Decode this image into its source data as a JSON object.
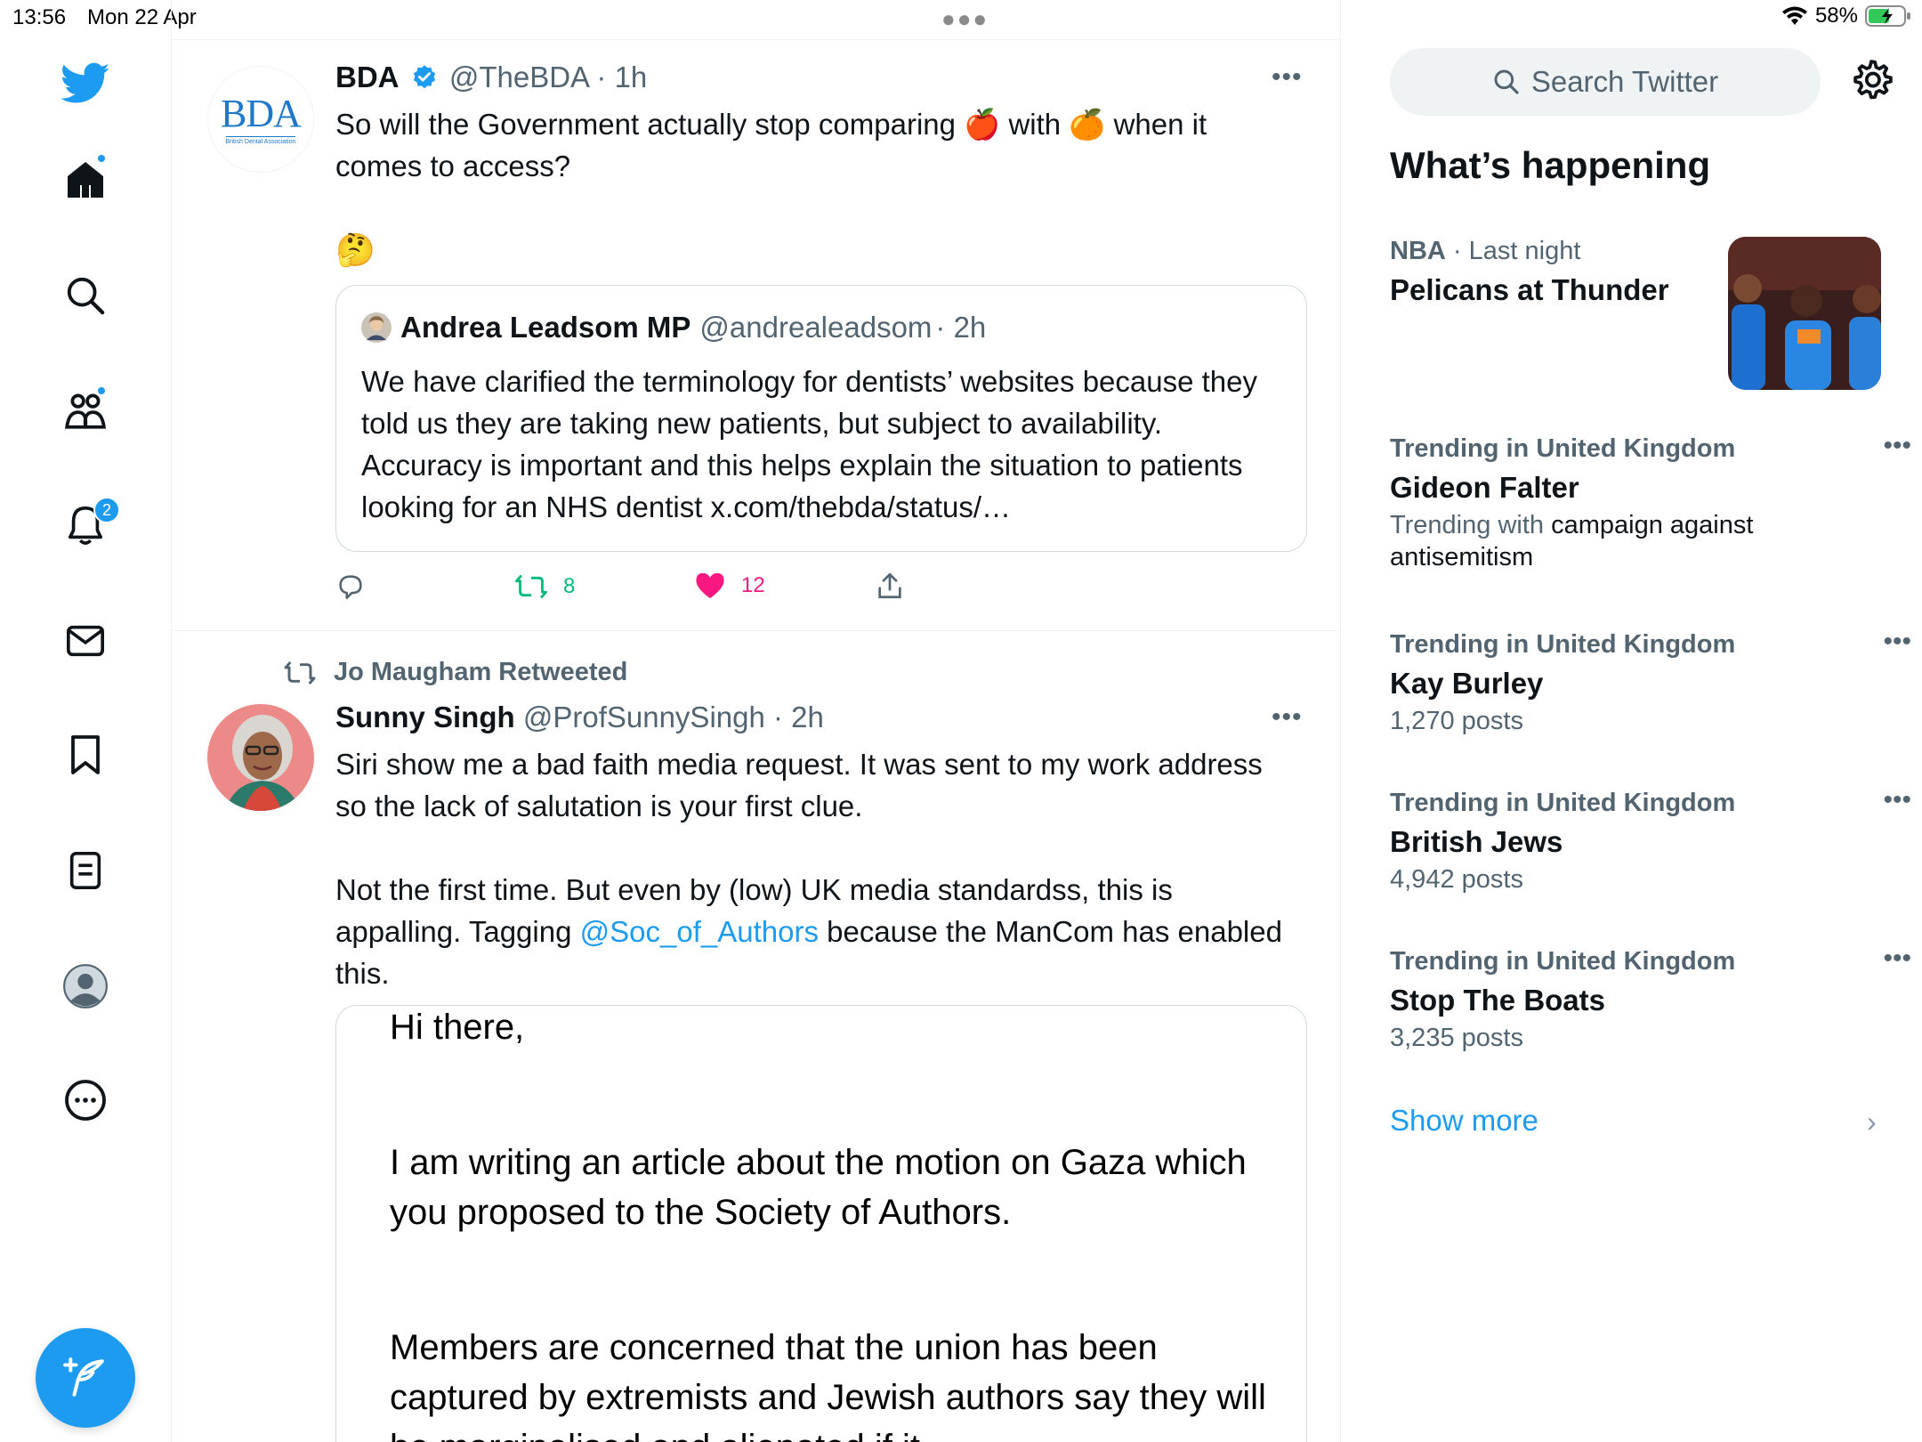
{
  "status_bar": {
    "time": "13:56",
    "date": "Mon 22 Apr",
    "battery": "58%"
  },
  "nav": {
    "notifications_badge": "2"
  },
  "feed": {
    "tweet1": {
      "name": "BDA",
      "handle": "@TheBDA",
      "time": "· 1h",
      "avatar_text": "BDA",
      "avatar_subtext": "British Dental Association",
      "body_line1_a": "So will the Government actually stop comparing",
      "body_line1_b": "with",
      "body_line1_c": "when it",
      "body_line2": "comes to access?",
      "emoji_apple": "🍎",
      "emoji_orange": "🍊",
      "emoji_think": "🤔",
      "quote": {
        "name": "Andrea Leadsom MP",
        "handle": "@andrealeadsom",
        "time": "· 2h",
        "text": "We have clarified the terminology for dentists’ websites because they told us they are taking new patients, but subject to availability. Accuracy is important and this helps explain the situation to patients looking for an NHS dentist x.com/thebda/status/…"
      },
      "retweets": "8",
      "likes": "12"
    },
    "tweet2": {
      "retweeted_by": "Jo Maugham Retweeted",
      "name": "Sunny Singh",
      "handle": "@ProfSunnySingh",
      "time": "· 2h",
      "body_p1": "Siri show me a bad faith media request. It was sent to my work address so the lack of salutation is your first clue.",
      "body_p2_a": "Not the first time. But even by (low) UK media standardss, this is appalling. Tagging",
      "body_p2_link": "@Soc_of_Authors",
      "body_p2_b": "because the ManCom has enabled this.",
      "email": {
        "line1": "Hi there,",
        "line2": "I am writing an article about the motion on Gaza which you proposed to the Society of Authors.",
        "line3": "Members are concerned that the union has been captured by extremists and Jewish authors say they will be marginalised and alienated if it"
      }
    }
  },
  "sidebar": {
    "search_placeholder": "Search Twitter",
    "title": "What’s happening",
    "trends": [
      {
        "meta_bold": "NBA",
        "meta": "· Last night",
        "title": "Pelicans at Thunder"
      },
      {
        "meta": "Trending in United Kingdom",
        "title": "Gideon Falter",
        "sub_a": "Trending with",
        "sub_b": "campaign against antisemitism"
      },
      {
        "meta": "Trending in United Kingdom",
        "title": "Kay Burley",
        "sub": "1,270 posts"
      },
      {
        "meta": "Trending in United Kingdom",
        "title": "British Jews",
        "sub": "4,942 posts"
      },
      {
        "meta": "Trending in United Kingdom",
        "title": "Stop The Boats",
        "sub": "3,235 posts"
      }
    ],
    "show_more": "Show more"
  },
  "colors": {
    "accent": "#1d9bf0",
    "text": "#0f1419",
    "muted": "#536471",
    "retweet": "#00ba7c",
    "like": "#f91880"
  }
}
